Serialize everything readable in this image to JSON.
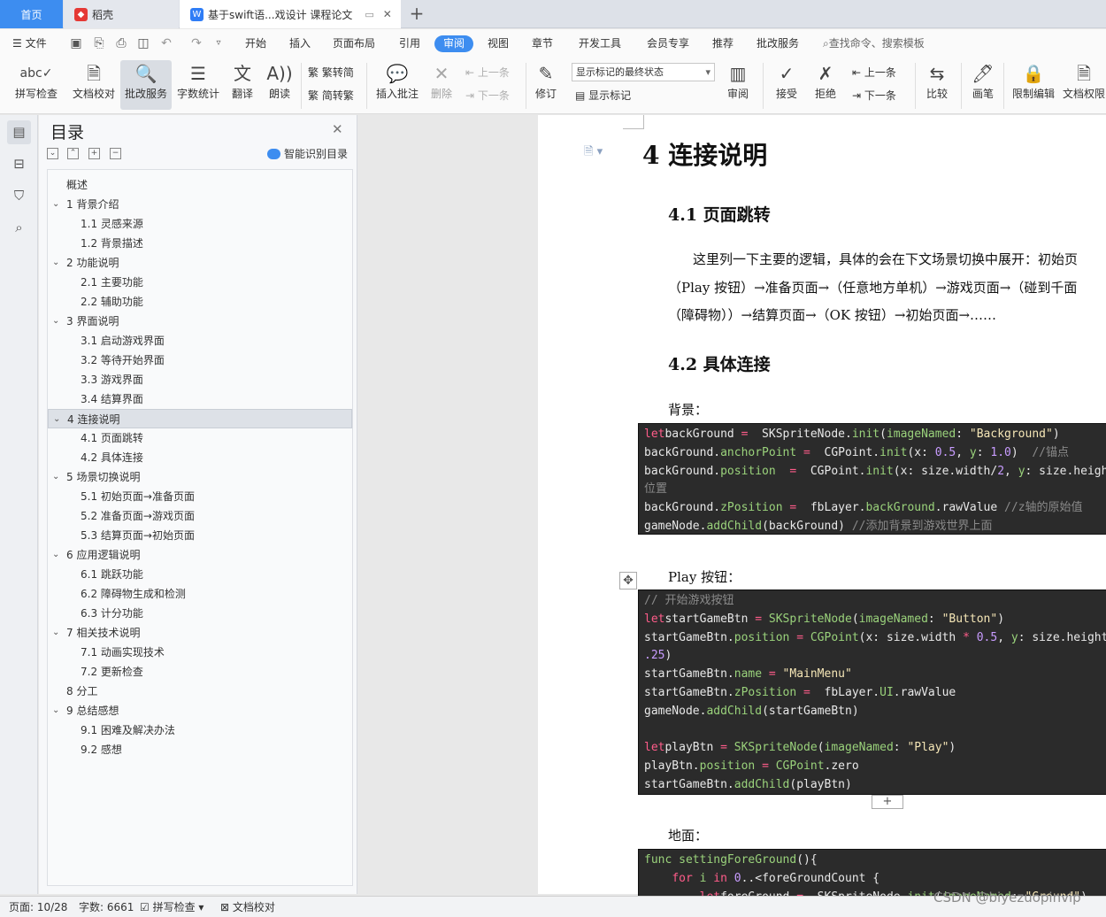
{
  "tabs": {
    "home": "首页",
    "daoke": "稻壳",
    "doc": "基于swift语...戏设计 课程论文"
  },
  "menu": {
    "file": "文件",
    "items": [
      "开始",
      "插入",
      "页面布局",
      "引用",
      "审阅",
      "视图",
      "章节",
      "开发工具",
      "会员专享",
      "推荐",
      "批改服务"
    ],
    "active": "审阅",
    "search": "查找命令、搜索模板"
  },
  "ribbon": {
    "spell": "拼写检查",
    "proof": "文档校对",
    "review_service": "批改服务",
    "word_count": "字数统计",
    "translate": "翻译",
    "read": "朗读",
    "trad": "繁转简",
    "simp": "简转繁",
    "insert_comment": "插入批注",
    "delete": "删除",
    "prev_comment": "上一条",
    "next_comment": "下一条",
    "revise": "修订",
    "markup_select": "显示标记的最终状态",
    "show_markup": "显示标记",
    "review": "审阅",
    "accept": "接受",
    "reject": "拒绝",
    "prev_change": "上一条",
    "next_change": "下一条",
    "compare": "比较",
    "pen": "画笔",
    "restrict": "限制编辑",
    "permission": "文档权限"
  },
  "toc": {
    "title": "目录",
    "smart": "智能识别目录",
    "items": [
      {
        "label": "概述"
      },
      {
        "label": "1  背景介绍"
      },
      {
        "label": "1.1 灵感来源"
      },
      {
        "label": "1.2 背景描述"
      },
      {
        "label": "2 功能说明"
      },
      {
        "label": "2.1  主要功能"
      },
      {
        "label": "2.2 辅助功能"
      },
      {
        "label": "3  界面说明"
      },
      {
        "label": "3.1  启动游戏界面"
      },
      {
        "label": "3.2  等待开始界面"
      },
      {
        "label": "3.3  游戏界面"
      },
      {
        "label": "3.4  结算界面"
      },
      {
        "label": "4  连接说明"
      },
      {
        "label": "4.1  页面跳转"
      },
      {
        "label": "4.2  具体连接"
      },
      {
        "label": "5  场景切换说明"
      },
      {
        "label": "5.1 初始页面→准备页面"
      },
      {
        "label": "5.2 准备页面→游戏页面"
      },
      {
        "label": "5.3 结算页面→初始页面"
      },
      {
        "label": "6  应用逻辑说明"
      },
      {
        "label": "6.1  跳跃功能"
      },
      {
        "label": "6.2  障碍物生成和检测"
      },
      {
        "label": "6.3  计分功能"
      },
      {
        "label": "7 相关技术说明"
      },
      {
        "label": "7.1 动画实现技术"
      },
      {
        "label": "7.2 更新检查"
      },
      {
        "label": "8  分工"
      },
      {
        "label": "9  总结感想"
      },
      {
        "label": "9.1  困难及解决办法"
      },
      {
        "label": "9.2  感想"
      }
    ]
  },
  "doc": {
    "h1": "4  连接说明",
    "h2_1": "4.1  页面跳转",
    "para1": "这里列一下主要的逻辑，具体的会在下文场景切换中展开：初始页",
    "para2": "（Play 按钮）→准备页面→（任意地方单机）→游戏页面→（碰到千面",
    "para3": "（障碍物））→结算页面→（OK 按钮）→初始页面→……",
    "h2_2": "4.2  具体连接",
    "label_bg": "背景：",
    "label_play": "Play 按钮：",
    "label_ground": "地面：",
    "code1": [
      [
        [
          "kw",
          "let"
        ],
        [
          "",
          "backGround "
        ],
        [
          "kw",
          "="
        ],
        [
          "",
          "  SKSpriteNode."
        ],
        [
          "fn",
          "init"
        ],
        [
          "",
          "("
        ],
        [
          "fn",
          "imageNamed"
        ],
        [
          "",
          ": "
        ],
        [
          "str",
          "\"Background\""
        ],
        [
          "",
          ")"
        ]
      ],
      [
        [
          "",
          "backGround."
        ],
        [
          "fn",
          "anchorPoint"
        ],
        [
          "kw",
          " ="
        ],
        [
          "",
          "  CGPoint."
        ],
        [
          "fn",
          "init"
        ],
        [
          "",
          "(x: "
        ],
        [
          "num",
          "0.5"
        ],
        [
          "",
          ", "
        ],
        [
          "fn",
          "y"
        ],
        [
          "",
          ": "
        ],
        [
          "num",
          "1.0"
        ],
        [
          "",
          ")  "
        ],
        [
          "cm",
          "//锚点"
        ]
      ],
      [
        [
          "",
          "backGround."
        ],
        [
          "fn",
          "position"
        ],
        [
          "",
          "  "
        ],
        [
          "kw",
          "="
        ],
        [
          "",
          "  CGPoint."
        ],
        [
          "fn",
          "init"
        ],
        [
          "",
          "(x: size.width/"
        ],
        [
          "num",
          "2"
        ],
        [
          "",
          ", "
        ],
        [
          "fn",
          "y"
        ],
        [
          "",
          ": size.height)"
        ]
      ],
      [
        [
          "cm",
          "位置"
        ]
      ],
      [
        [
          "",
          "backGround."
        ],
        [
          "fn",
          "zPosition"
        ],
        [
          "kw",
          " ="
        ],
        [
          "",
          "  fbLayer."
        ],
        [
          "fn",
          "backGround"
        ],
        [
          "",
          ".rawValue "
        ],
        [
          "cm",
          "//z轴的原始值"
        ]
      ],
      [
        [
          "",
          "gameNode."
        ],
        [
          "fn",
          "addChild"
        ],
        [
          "",
          "(backGround) "
        ],
        [
          "cm",
          "//添加背景到游戏世界上面"
        ]
      ]
    ],
    "code2": [
      [
        [
          "cm",
          "// 开始游戏按钮"
        ]
      ],
      [
        [
          "kw",
          "let"
        ],
        [
          "",
          "startGameBtn "
        ],
        [
          "kw",
          "="
        ],
        [
          "",
          ""
        ],
        [
          "fn",
          " SKSpriteNode"
        ],
        [
          "",
          "("
        ],
        [
          "fn",
          "imageNamed"
        ],
        [
          "",
          ": "
        ],
        [
          "str",
          "\"Button\""
        ],
        [
          "",
          ")"
        ]
      ],
      [
        [
          "",
          "startGameBtn."
        ],
        [
          "fn",
          "position"
        ],
        [
          "kw",
          " ="
        ],
        [
          "fn",
          " CGPoint"
        ],
        [
          "",
          "(x: size.width "
        ],
        [
          "kw",
          "*"
        ],
        [
          "num",
          " 0.5"
        ],
        [
          "",
          ", "
        ],
        [
          "fn",
          "y"
        ],
        [
          "",
          ": size.height"
        ]
      ],
      [
        [
          "num",
          ".25"
        ],
        [
          "",
          ")"
        ]
      ],
      [
        [
          "",
          "startGameBtn."
        ],
        [
          "fn",
          "name"
        ],
        [
          "kw",
          " ="
        ],
        [
          "str",
          " \"MainMenu\""
        ]
      ],
      [
        [
          "",
          "startGameBtn."
        ],
        [
          "fn",
          "zPosition"
        ],
        [
          "kw",
          " ="
        ],
        [
          "",
          "  fbLayer."
        ],
        [
          "fn",
          "UI"
        ],
        [
          "",
          ".rawValue"
        ]
      ],
      [
        [
          "",
          "gameNode."
        ],
        [
          "fn",
          "addChild"
        ],
        [
          "",
          "(startGameBtn)"
        ]
      ],
      [
        [
          "",
          ""
        ]
      ],
      [
        [
          "kw",
          "let"
        ],
        [
          "",
          "playBtn "
        ],
        [
          "kw",
          "="
        ],
        [
          "fn",
          " SKSpriteNode"
        ],
        [
          "",
          "("
        ],
        [
          "fn",
          "imageNamed"
        ],
        [
          "",
          ": "
        ],
        [
          "str",
          "\"Play\""
        ],
        [
          "",
          ")"
        ]
      ],
      [
        [
          "",
          "playBtn."
        ],
        [
          "fn",
          "position"
        ],
        [
          "kw",
          " ="
        ],
        [
          "",
          ""
        ],
        [
          "fn",
          " CGPoint"
        ],
        [
          "",
          ".zero"
        ]
      ],
      [
        [
          "",
          "startGameBtn."
        ],
        [
          "fn",
          "addChild"
        ],
        [
          "",
          "(playBtn)"
        ]
      ]
    ],
    "code3": [
      [
        [
          "fn",
          "func"
        ],
        [
          "",
          ""
        ],
        [
          "fn",
          " settingForeGround"
        ],
        [
          "",
          "(){"
        ]
      ],
      [
        [
          "",
          "    "
        ],
        [
          "kw",
          "for"
        ],
        [
          "",
          ""
        ],
        [
          "fn",
          " i"
        ],
        [
          "kw",
          " in"
        ],
        [
          "num",
          " 0"
        ],
        [
          "",
          "..<foreGroundCount {"
        ]
      ],
      [
        [
          "",
          "        "
        ],
        [
          "kw",
          "let"
        ],
        [
          "",
          ""
        ],
        [
          "",
          ""
        ],
        [
          "",
          ""
        ],
        [
          "",
          "foreGround "
        ],
        [
          "kw",
          "="
        ],
        [
          "",
          "  SKSpriteNode."
        ],
        [
          "fn",
          "init"
        ],
        [
          "",
          "("
        ],
        [
          "fn",
          "imageNamed"
        ],
        [
          "",
          ": "
        ],
        [
          "str",
          "\"Ground\""
        ],
        [
          "",
          ")"
        ]
      ]
    ]
  },
  "status": {
    "page": "页面: 10/28",
    "words": "字数: 6661",
    "spell": "拼写检查",
    "proof": "文档校对"
  },
  "watermark": "CSDN @biyezuopinvip"
}
